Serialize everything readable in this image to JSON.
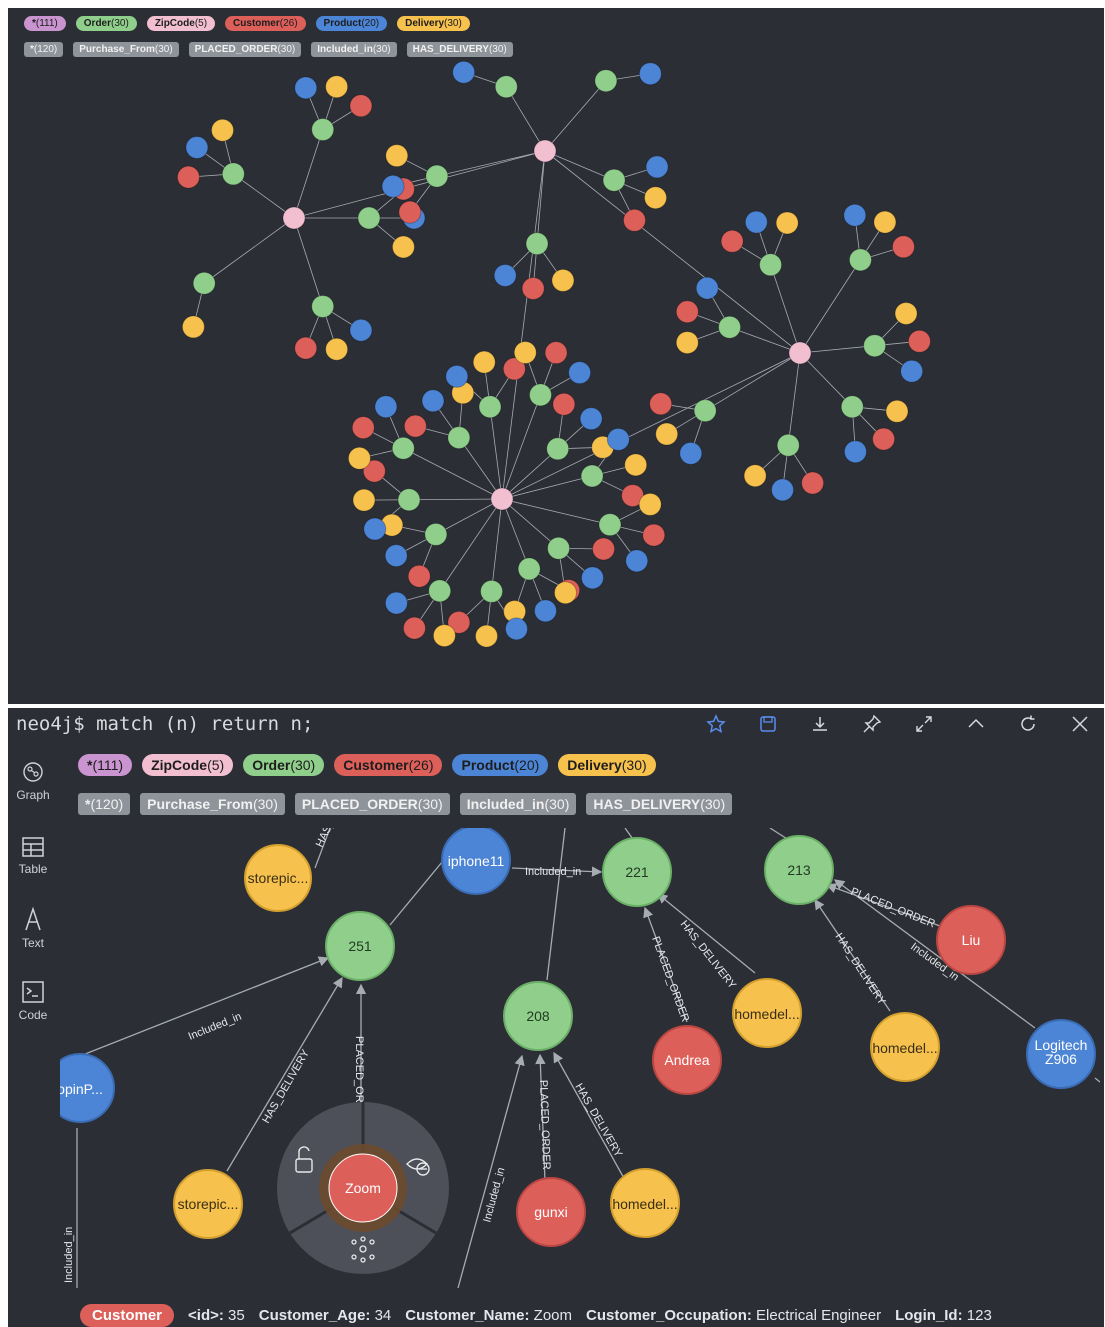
{
  "colors": {
    "background": "#2b2e35",
    "order": "#8fcf8b",
    "zipcode": "#f2bfd0",
    "customer": "#dd5f5a",
    "product": "#4c84d6",
    "delivery": "#f7c14d",
    "all_nodes": "#c994cf",
    "relationship": "#8f939a",
    "edge": "#a7abb2"
  },
  "top_view": {
    "node_labels": [
      {
        "name": "*",
        "count": "(111)",
        "color": "#c994cf"
      },
      {
        "name": "Order",
        "count": "(30)",
        "color": "#8fcf8b"
      },
      {
        "name": "ZipCode",
        "count": "(5)",
        "color": "#f2bfd0"
      },
      {
        "name": "Customer",
        "count": "(26)",
        "color": "#dd5f5a"
      },
      {
        "name": "Product",
        "count": "(20)",
        "color": "#4c84d6"
      },
      {
        "name": "Delivery",
        "count": "(30)",
        "color": "#f7c14d"
      }
    ],
    "relationship_types": [
      {
        "name": "*",
        "count": "(120)"
      },
      {
        "name": "Purchase_From",
        "count": "(30)"
      },
      {
        "name": "PLACED_ORDER",
        "count": "(30)"
      },
      {
        "name": "Included_in",
        "count": "(30)"
      },
      {
        "name": "HAS_DELIVERY",
        "count": "(30)"
      }
    ]
  },
  "bottom_view": {
    "query": "neo4j$ match (n) return n;",
    "toolbar_icons": [
      "star-icon",
      "save-icon",
      "download-icon",
      "pin-icon",
      "expand-icon",
      "collapse-icon",
      "refresh-icon",
      "close-icon"
    ],
    "nav": [
      {
        "label": "Graph",
        "icon": "graph-icon"
      },
      {
        "label": "Table",
        "icon": "table-icon"
      },
      {
        "label": "Text",
        "icon": "text-icon"
      },
      {
        "label": "Code",
        "icon": "code-icon"
      }
    ],
    "node_labels": [
      {
        "name": "*",
        "count": "(111)",
        "color": "#c994cf"
      },
      {
        "name": "ZipCode",
        "count": "(5)",
        "color": "#f2bfd0"
      },
      {
        "name": "Order",
        "count": "(30)",
        "color": "#8fcf8b"
      },
      {
        "name": "Customer",
        "count": "(26)",
        "color": "#dd5f5a"
      },
      {
        "name": "Product",
        "count": "(20)",
        "color": "#4c84d6"
      },
      {
        "name": "Delivery",
        "count": "(30)",
        "color": "#f7c14d"
      }
    ],
    "relationship_types": [
      {
        "name": "*",
        "count": "(120)"
      },
      {
        "name": "Purchase_From",
        "count": "(30)"
      },
      {
        "name": "PLACED_ORDER",
        "count": "(30)"
      },
      {
        "name": "Included_in",
        "count": "(30)"
      },
      {
        "name": "HAS_DELIVERY",
        "count": "(30)"
      }
    ],
    "graph": {
      "nodes": {
        "o251": "251",
        "o221": "221",
        "o213": "213",
        "o208": "208",
        "iphone11": "iphone11",
        "logitech": "Logitech\nZ906",
        "popin": "opinP...",
        "andrea": "Andrea",
        "liu": "Liu",
        "gunxi": "gunxi",
        "zoom": "Zoom",
        "storepic1": "storepic...",
        "storepic2": "storepic...",
        "homedel1": "homedel...",
        "homedel2": "homedel...",
        "homedel3": "homedel..."
      },
      "edge_labels": {
        "e_has_top": "HAS_",
        "e_included_iphone": "Included_in",
        "e_included_popin": "Included_in",
        "e_has_storepic": "HAS_DELIVERY",
        "e_placed_zoom": "PLACED_ORD",
        "e_placed_andrea": "PLACED_ORDER",
        "e_has_221": "HAS_DELIVERY",
        "e_placed_liu": "PLACED_ORDER",
        "e_has_213": "HAS_DELIVERY",
        "e_included_logitech": "Included_in",
        "e_placed_gunxi": "PLACED_ORDER",
        "e_has_208": "HAS_DELIVERY",
        "e_included_bottom": "Included_in",
        "e_included_left": "Included_in"
      }
    },
    "properties": {
      "label": "Customer",
      "items": [
        {
          "key": "<id>:",
          "value": "35"
        },
        {
          "key": "Customer_Age:",
          "value": "34"
        },
        {
          "key": "Customer_Name:",
          "value": "Zoom"
        },
        {
          "key": "Customer_Occupation:",
          "value": "Electrical Engineer"
        },
        {
          "key": "Login_Id:",
          "value": "123"
        }
      ]
    }
  }
}
